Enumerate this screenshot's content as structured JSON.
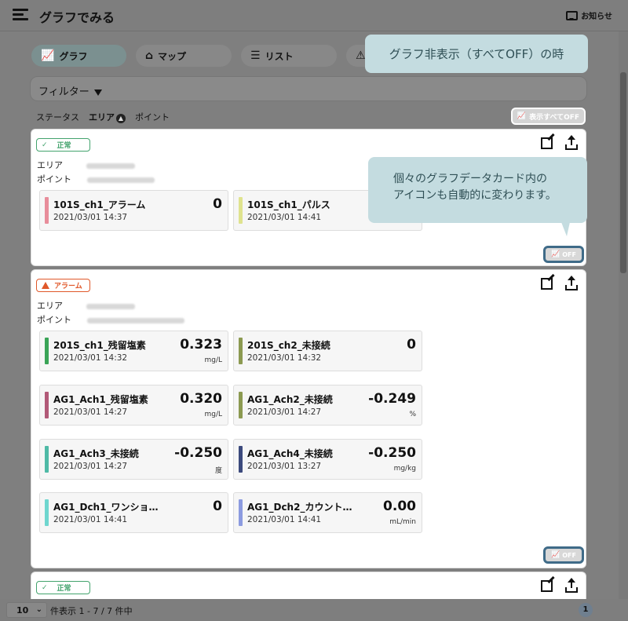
{
  "header": {
    "title": "グラフでみる",
    "notice_label": "お知らせ"
  },
  "tabs": [
    {
      "label": "グラフ",
      "icon": "line-chart-icon"
    },
    {
      "label": "マップ",
      "icon": "map-pin-icon"
    },
    {
      "label": "リスト",
      "icon": "list-icon"
    }
  ],
  "callouts": {
    "top": "グラフ非表示（すべてOFF）の時",
    "mid_line1": "個々のグラフデータカード内の",
    "mid_line2": "アイコンも自動的に変わります。"
  },
  "filter": {
    "label": "フィルター"
  },
  "sort": {
    "status": "ステータス",
    "area": "エリア",
    "point": "ポイント"
  },
  "all_off_button": "表示すべてOFF",
  "meta_labels": {
    "area": "エリア",
    "point": "ポイント"
  },
  "cards": [
    {
      "status": "正常",
      "tiles": [
        {
          "name": "101S_ch1_アラーム",
          "time": "2021/03/01 14:37",
          "value": "0",
          "unit": "",
          "color": "#e88d9b"
        },
        {
          "name": "101S_ch1_パルス",
          "time": "2021/03/01 14:41",
          "value": "",
          "unit": "",
          "color": "#dfe38e"
        }
      ],
      "off_label": "OFF"
    },
    {
      "status": "アラーム",
      "tiles": [
        {
          "name": "201S_ch1_残留塩素",
          "time": "2021/03/01 14:32",
          "value": "0.323",
          "unit": "mg/L",
          "color": "#3aa457"
        },
        {
          "name": "201S_ch2_未接続",
          "time": "2021/03/01 14:32",
          "value": "0",
          "unit": "",
          "color": "#8c9a51"
        },
        {
          "name": "AG1_Ach1_残留塩素",
          "time": "2021/03/01 14:27",
          "value": "0.320",
          "unit": "mg/L",
          "color": "#b25a78"
        },
        {
          "name": "AG1_Ach2_未接続",
          "time": "2021/03/01 14:27",
          "value": "-0.249",
          "unit": "%",
          "color": "#8c9a51"
        },
        {
          "name": "AG1_Ach3_未接続",
          "time": "2021/03/01 14:27",
          "value": "-0.250",
          "unit": "度",
          "color": "#4fbaa6"
        },
        {
          "name": "AG1_Ach4_未接続",
          "time": "2021/03/01 13:27",
          "value": "-0.250",
          "unit": "mg/kg",
          "color": "#3c4a7d"
        },
        {
          "name": "AG1_Dch1_ワンショ…",
          "time": "2021/03/01 14:41",
          "value": "0",
          "unit": "",
          "color": "#6fd6cf"
        },
        {
          "name": "AG1_Dch2_カウント…",
          "time": "2021/03/01 14:41",
          "value": "0.00",
          "unit": "mL/min",
          "color": "#8c9be0"
        }
      ],
      "off_label": "OFF"
    },
    {
      "status": "正常"
    }
  ],
  "footer": {
    "page_size": "10",
    "per_page_text": "件表示 1 - 7 / 7 件中",
    "page": "1"
  }
}
